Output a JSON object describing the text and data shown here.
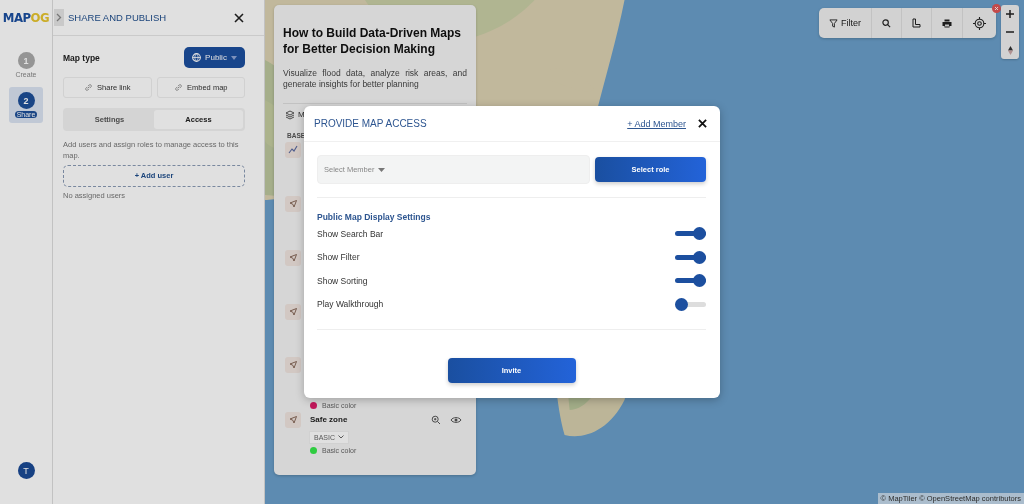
{
  "rail": {
    "logo": {
      "primary": "MAP",
      "accent": "OG"
    },
    "steps": [
      {
        "number": "1",
        "label": "Create",
        "selected": false
      },
      {
        "number": "2",
        "label": "Share",
        "selected": true
      }
    ],
    "avatar": "T"
  },
  "share_panel": {
    "title": "SHARE AND PUBLISH",
    "map_type_label": "Map type",
    "map_type_value": "Public",
    "links": [
      "Share link",
      "Embed map"
    ],
    "tabs": [
      {
        "label": "Settings",
        "selected": false
      },
      {
        "label": "Access",
        "selected": true
      }
    ],
    "description": "Add users and assign roles to manage access to this map.",
    "add_user": "+ Add user",
    "empty_text": "No assigned users"
  },
  "story_panel": {
    "title": "How to Build Data-Driven Maps for Better Decision Making",
    "description": "Visualize flood data, analyze risk areas, and generate insights for better planning",
    "layers_label": "M",
    "section_label": "BASE",
    "layers": [
      {
        "kind": "line"
      },
      {
        "kind": "point"
      },
      {
        "kind": "point"
      },
      {
        "kind": "point"
      },
      {
        "kind": "point",
        "color_label": "Basic color",
        "color": "#c2185b"
      },
      {
        "kind": "point",
        "name": "Safe zone",
        "style": "BASIC",
        "color_label": "Basic color",
        "color": "#2ecc40"
      }
    ]
  },
  "map": {
    "kind": "picture",
    "filter_label": "Filter",
    "attribution": "© MapTiler © OpenStreetMap contributors"
  },
  "modal": {
    "title": "PROVIDE MAP ACCESS",
    "add_member": "+ Add Member",
    "member_placeholder": "Select Member",
    "role_button": "Select role",
    "section_title": "Public Map Display Settings",
    "settings": [
      {
        "label": "Show Search Bar",
        "on": true
      },
      {
        "label": "Show Filter",
        "on": true
      },
      {
        "label": "Show Sorting",
        "on": true
      },
      {
        "label": "Play Walkthrough",
        "on": false
      }
    ],
    "invite": "Invite"
  }
}
